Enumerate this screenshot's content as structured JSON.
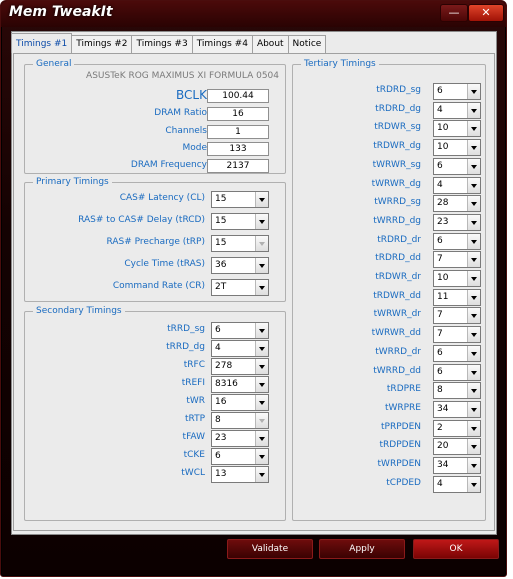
{
  "window": {
    "title": "Mem TweakIt",
    "minimize_glyph": "—",
    "close_glyph": "✕"
  },
  "tabs": [
    {
      "label": "Timings #1"
    },
    {
      "label": "Timings #2"
    },
    {
      "label": "Timings #3"
    },
    {
      "label": "Timings #4"
    },
    {
      "label": "About"
    },
    {
      "label": "Notice"
    }
  ],
  "general": {
    "title": "General",
    "board": "ASUSTeK ROG MAXIMUS XI FORMULA 0504",
    "bclk_label": "BCLK",
    "bclk": "100.44",
    "ratio_label": "DRAM Ratio",
    "ratio": "16",
    "channels_label": "Channels",
    "channels": "1",
    "mode_label": "Mode",
    "mode": "133",
    "freq_label": "DRAM Frequency",
    "freq": "2137"
  },
  "primary": {
    "title": "Primary Timings",
    "rows": [
      {
        "label": "CAS# Latency (CL)",
        "value": "15"
      },
      {
        "label": "RAS# to CAS# Delay (tRCD)",
        "value": "15"
      },
      {
        "label": "RAS# Precharge (tRP)",
        "value": "15"
      },
      {
        "label": "Cycle Time (tRAS)",
        "value": "36"
      },
      {
        "label": "Command Rate (CR)",
        "value": "2T"
      }
    ]
  },
  "secondary": {
    "title": "Secondary Timings",
    "rows": [
      {
        "label": "tRRD_sg",
        "value": "6"
      },
      {
        "label": "tRRD_dg",
        "value": "4"
      },
      {
        "label": "tRFC",
        "value": "278"
      },
      {
        "label": "tREFI",
        "value": "8316"
      },
      {
        "label": "tWR",
        "value": "16"
      },
      {
        "label": "tRTP",
        "value": "8"
      },
      {
        "label": "tFAW",
        "value": "23"
      },
      {
        "label": "tCKE",
        "value": "6"
      },
      {
        "label": "tWCL",
        "value": "13"
      }
    ]
  },
  "tertiary": {
    "title": "Tertiary Timings",
    "rows": [
      {
        "label": "tRDRD_sg",
        "value": "6"
      },
      {
        "label": "tRDRD_dg",
        "value": "4"
      },
      {
        "label": "tRDWR_sg",
        "value": "10"
      },
      {
        "label": "tRDWR_dg",
        "value": "10"
      },
      {
        "label": "tWRWR_sg",
        "value": "6"
      },
      {
        "label": "tWRWR_dg",
        "value": "4"
      },
      {
        "label": "tWRRD_sg",
        "value": "28"
      },
      {
        "label": "tWRRD_dg",
        "value": "23"
      },
      {
        "label": "tRDRD_dr",
        "value": "6"
      },
      {
        "label": "tRDRD_dd",
        "value": "7"
      },
      {
        "label": "tRDWR_dr",
        "value": "10"
      },
      {
        "label": "tRDWR_dd",
        "value": "11"
      },
      {
        "label": "tWRWR_dr",
        "value": "7"
      },
      {
        "label": "tWRWR_dd",
        "value": "7"
      },
      {
        "label": "tWRRD_dr",
        "value": "6"
      },
      {
        "label": "tWRRD_dd",
        "value": "6"
      },
      {
        "label": "tRDPRE",
        "value": "8"
      },
      {
        "label": "tWRPRE",
        "value": "34"
      },
      {
        "label": "tPRPDEN",
        "value": "2"
      },
      {
        "label": "tRDPDEN",
        "value": "20"
      },
      {
        "label": "tWRPDEN",
        "value": "34"
      },
      {
        "label": "tCPDED",
        "value": "4"
      }
    ]
  },
  "buttons": {
    "validate": "Validate",
    "apply": "Apply",
    "ok": "OK"
  },
  "colors": {
    "label": "#1a6bc0",
    "accent": "#c01818",
    "frame": "#140202"
  }
}
